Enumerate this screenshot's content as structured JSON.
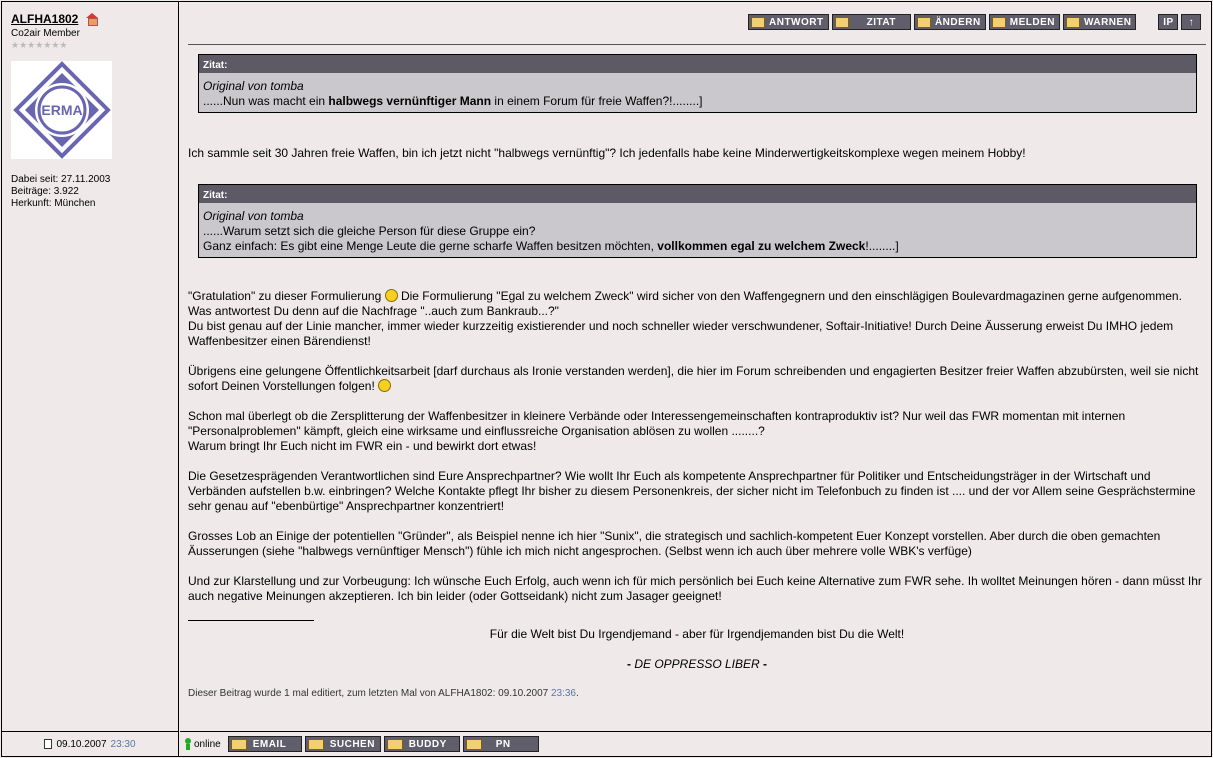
{
  "user": {
    "name": "ALFHA1802",
    "rank": "Co2air Member",
    "stars": "★★★★★★★",
    "joined": "Dabei seit: 27.11.2003",
    "posts": "Beiträge: 3.922",
    "origin": "Herkunft: München",
    "avatar_text": "ERMA"
  },
  "buttons": {
    "reply": "ANTWORT",
    "quote": "ZITAT",
    "edit": "ÄNDERN",
    "report": "MELDEN",
    "warn": "WARNEN",
    "ip": "IP",
    "up": "↑"
  },
  "quote1": {
    "header": "Zitat:",
    "author": "Original von tomba",
    "pre": "......Nun was macht ein ",
    "bold": "halbwegs vernünftiger Mann",
    "post": " in einem Forum für freie Waffen?!........]"
  },
  "para1": "Ich sammle seit 30 Jahren freie Waffen, bin ich jetzt nicht \"halbwegs vernünftig\"? Ich jedenfalls habe keine Minderwertigkeitskomplexe wegen meinem Hobby!",
  "quote2": {
    "header": "Zitat:",
    "author": "Original von tomba",
    "line1": "......Warum setzt sich die gleiche Person für diese Gruppe ein?",
    "line2_pre": "Ganz einfach: Es gibt eine Menge Leute die gerne scharfe Waffen besitzen möchten, ",
    "line2_bold": "vollkommen egal zu welchem Zweck",
    "line2_post": "!........]"
  },
  "para2a": "\"Gratulation\" zu dieser Formulierung ",
  "para2b": " Die Formulierung \"Egal zu welchem Zweck\" wird sicher von den Waffengegnern und den einschlägigen Boulevardmagazinen gerne aufgenommen. Was antwortest Du denn auf die Nachfrage \"..auch zum Bankraub...?\"",
  "para2c": "Du bist genau auf der Linie mancher, immer wieder kurzzeitig existierender und noch schneller wieder verschwundener, Softair-Initiative! Durch Deine Äusserung erweist Du IMHO jedem Waffenbesitzer einen Bärendienst!",
  "para3": "Übrigens eine gelungene Öffentlichkeitsarbeit [darf durchaus als Ironie verstanden werden], die hier im Forum schreibenden und engagierten Besitzer freier Waffen abzubürsten, weil sie nicht sofort Deinen Vorstellungen folgen! ",
  "para4a": "Schon mal überlegt ob die Zersplitterung der Waffenbesitzer in kleinere Verbände oder Interessengemeinschaften kontraproduktiv ist? Nur weil das FWR momentan mit internen \"Personalproblemen\" kämpft, gleich eine wirksame und einflussreiche Organisation ablösen zu wollen ........?",
  "para4b": "Warum bringt Ihr Euch nicht im FWR ein - und bewirkt dort etwas!",
  "para5": "Die Gesetzesprägenden Verantwortlichen sind Eure Ansprechpartner? Wie wollt Ihr Euch als kompetente Ansprechpartner für Politiker und Entscheidungsträger in der Wirtschaft und Verbänden aufstellen b.w. einbringen? Welche Kontakte pflegt Ihr bisher zu diesem Personenkreis, der sicher nicht im Telefonbuch zu finden ist .... und der vor Allem seine Gesprächstermine sehr genau auf \"ebenbürtige\" Ansprechpartner konzentriert!",
  "para6": "Grosses Lob an Einige der potentiellen \"Gründer\", als Beispiel nenne ich hier \"Sunix\", die strategisch und sachlich-kompetent Euer Konzept vorstellen. Aber durch die oben gemachten Äusserungen (siehe \"halbwegs vernünftiger Mensch\") fühle ich mich nicht angesprochen. (Selbst wenn ich auch über mehrere volle WBK's verfüge)",
  "para7": "Und zur Klarstellung und zur Vorbeugung: Ich wünsche Euch Erfolg, auch wenn ich für mich persönlich bei Euch keine Alternative zum FWR sehe. Ih wolltet Meinungen hören - dann müsst Ihr auch negative Meinungen akzeptieren. Ich bin leider (oder Gottseidank) nicht zum Jasager geeignet!",
  "sig1": "Für die Welt bist Du Irgendjemand - aber für Irgendjemanden bist Du die Welt!",
  "sig2": "DE OPPRESSO LIBER",
  "sig2_pre": "- ",
  "sig2_post": " -",
  "edited_text": "Dieser Beitrag wurde 1 mal editiert, zum letzten Mal von ALFHA1802: 09.10.2007 ",
  "edited_time": "23:36",
  "edited_dot": ".",
  "footer": {
    "date": "09.10.2007",
    "time": "23:30",
    "online": "online",
    "email": "EMAIL",
    "search": "SUCHEN",
    "buddy": "BUDDY",
    "pm": "PN"
  }
}
